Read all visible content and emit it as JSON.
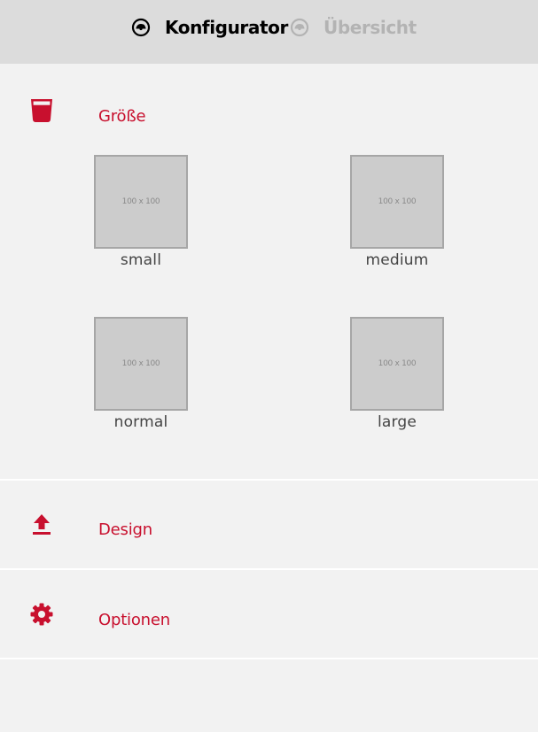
{
  "header": {
    "tabs": [
      {
        "label": "Konfigurator",
        "icon": "dashboard-icon",
        "active": true
      },
      {
        "label": "Übersicht",
        "icon": "dashboard-icon",
        "active": false
      }
    ]
  },
  "sections": {
    "size": {
      "label": "Größe",
      "icon": "cup-icon",
      "options": [
        {
          "label": "small",
          "thumb": "100 x 100"
        },
        {
          "label": "medium",
          "thumb": "100 x 100"
        },
        {
          "label": "normal",
          "thumb": "100 x 100"
        },
        {
          "label": "large",
          "thumb": "100 x 100"
        }
      ]
    },
    "design": {
      "label": "Design",
      "icon": "upload-icon"
    },
    "options": {
      "label": "Optionen",
      "icon": "gear-icon"
    }
  },
  "colors": {
    "accent": "#c8102e",
    "header_bg": "#dcdcdc",
    "page_bg": "#f2f2f2",
    "inactive_tab": "#b3b3b3"
  }
}
